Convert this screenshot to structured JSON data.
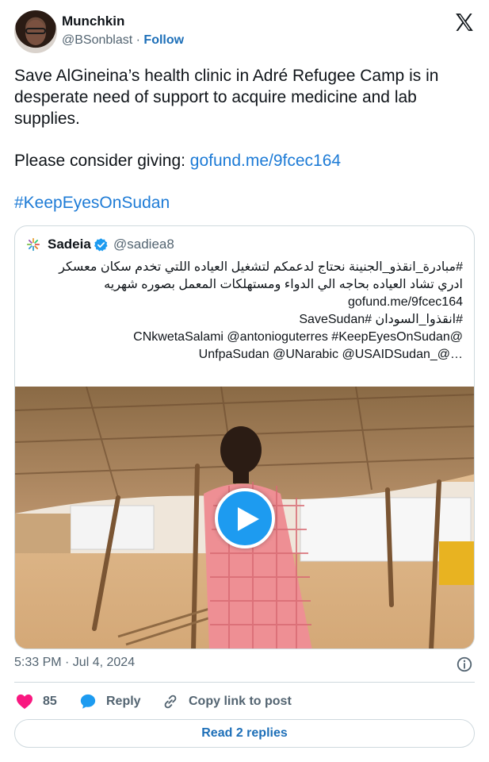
{
  "author": {
    "display_name": "Munchkin",
    "handle": "@BSonblast",
    "separator": "·",
    "follow_label": "Follow"
  },
  "tweet": {
    "text_p1": "Save AlGineina’s health clinic in Adré Refugee Camp is in desperate need of support to acquire medicine and lab supplies.",
    "text_p2_prefix": "Please consider giving: ",
    "text_p2_link": "gofund.me/9fcec164",
    "hashtag": "#KeepEyesOnSudan"
  },
  "quoted": {
    "name": "Sadeia",
    "handle": "@sadiea8",
    "lines": [
      "#مبادرة_انقذو_الجنينة نحتاج لدعمكم لتشغيل العياده اللتي تخدم سكان معسكر",
      "ادري تشاد العياده بحاجه الي الدواء ومستهلكات المعمل بصوره شهريه",
      "gofund.me/9fcec164",
      "#انقذوا_السودان #SaveSudan",
      "@CNkwetaSalami @antonioguterres #KeepEyesOnSudan",
      "…@_UnfpaSudan @UNarabic @USAIDSudan"
    ]
  },
  "meta": {
    "timestamp": "5:33 PM · Jul 4, 2024"
  },
  "actions": {
    "like_count": "85",
    "reply_label": "Reply",
    "copy_label": "Copy link to post"
  },
  "footer": {
    "read_replies_label": "Read 2 replies"
  },
  "colors": {
    "accent": "#1d9bf0",
    "link": "#1d7bd6",
    "like": "#f91880",
    "muted": "#536471",
    "border": "#cfd9de"
  },
  "icons": [
    "x-logo-icon",
    "verified-badge-icon",
    "play-icon",
    "info-icon",
    "heart-icon",
    "reply-bubble-icon",
    "link-icon"
  ]
}
